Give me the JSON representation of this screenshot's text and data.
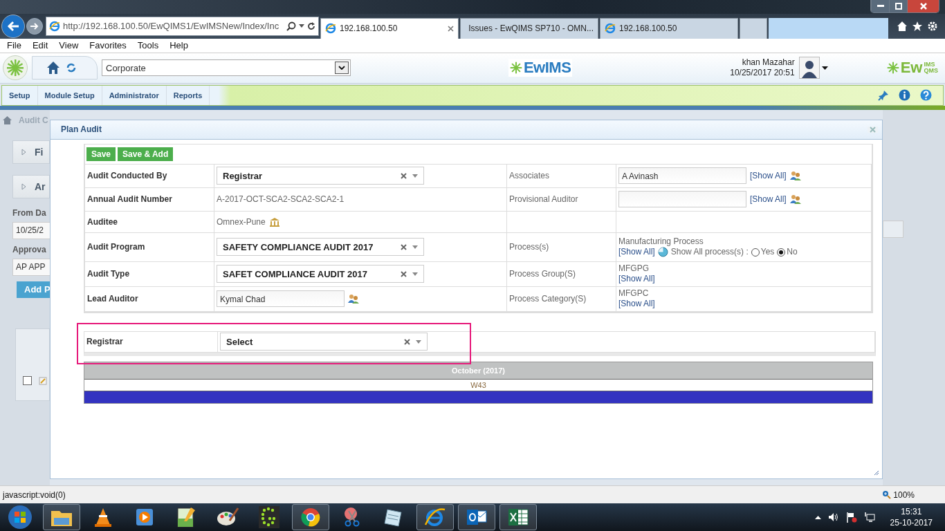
{
  "browser": {
    "url": "http://192.168.100.50/EwQIMS1/EwIMSNew/Index/Inc",
    "tabs": [
      {
        "title": "192.168.100.50",
        "selected": true,
        "kind": "globe"
      },
      {
        "title": "Issues - EwQIMS SP710 - OMN...",
        "selected": false,
        "kind": "gauge"
      },
      {
        "title": "192.168.100.50",
        "selected": false,
        "kind": "globe"
      }
    ],
    "menu": [
      "File",
      "Edit",
      "View",
      "Favorites",
      "Tools",
      "Help"
    ]
  },
  "header": {
    "site": "Corporate",
    "logo": "EwIMS",
    "user": "khan Mazahar",
    "datetime": "10/25/2017 20:51",
    "brand": {
      "main": "Ew",
      "top": "IMS",
      "bottom": "QMS"
    },
    "nav": [
      "Setup",
      "Module Setup",
      "Administrator",
      "Reports"
    ]
  },
  "background": {
    "breadcrumb": "Audit C",
    "panels": [
      "Fi",
      "Ar"
    ],
    "from_label": "From Da",
    "from_value": "10/25/2",
    "approval_label": "Approva",
    "approval_value": "AP APP",
    "add_button": "Add P",
    "row_checked": false
  },
  "dialog": {
    "title": "Plan Audit",
    "buttons": [
      "Save",
      "Save & Add"
    ],
    "left": [
      {
        "label": "Audit Conducted By",
        "kind": "select",
        "value": "Registrar"
      },
      {
        "label": "Annual Audit Number",
        "kind": "text",
        "value": "A-2017-OCT-SCA2-SCA2-SCA2-1"
      },
      {
        "label": "Auditee",
        "kind": "place",
        "value": "Omnex-Pune"
      },
      {
        "label": "Audit Program",
        "kind": "select",
        "value": "SAFETY COMPLIANCE AUDIT 2017"
      },
      {
        "label": "Audit Type",
        "kind": "select",
        "value": "SAFET COMPLIANCE AUDIT 2017"
      },
      {
        "label": "Lead Auditor",
        "kind": "person",
        "value": "Kymal Chad"
      }
    ],
    "right": [
      {
        "label": "Associates",
        "kind": "picker",
        "value": "A Avinash",
        "link": "[Show All]"
      },
      {
        "label": "Provisional Auditor",
        "kind": "picker",
        "link": "[Show All]"
      },
      {
        "kind": "empty"
      },
      {
        "label": "Process(s)",
        "kind": "process",
        "value": "Manufacturing Process",
        "link": "[Show All]",
        "question": "Show All process(s) :",
        "options": [
          {
            "label": "Yes",
            "selected": false
          },
          {
            "label": "No",
            "selected": true
          }
        ]
      },
      {
        "label": "Process Group(S)",
        "kind": "list",
        "value": "MFGPG",
        "link": "[Show All]"
      },
      {
        "label": "Process Category(S)",
        "kind": "list",
        "value": "MFGPC",
        "link": "[Show All]"
      }
    ],
    "registrar": {
      "label": "Registrar",
      "value": "Select"
    },
    "calendar": {
      "month": "October (2017)",
      "week": "W43"
    }
  },
  "status_bar": {
    "text": "javascript:void(0)",
    "zoom": "100%"
  },
  "taskbar": {
    "apps": [
      {
        "kind": "folder",
        "running": true
      },
      {
        "kind": "cone",
        "running": false
      },
      {
        "kind": "player",
        "running": false
      },
      {
        "kind": "editor",
        "running": false
      },
      {
        "kind": "palette",
        "running": false
      },
      {
        "kind": "dots",
        "running": false
      },
      {
        "kind": "browser",
        "running": true
      },
      {
        "kind": "scissors",
        "running": false
      },
      {
        "kind": "notepad",
        "running": false
      },
      {
        "kind": "globe",
        "running": true
      },
      {
        "kind": "mail",
        "running": true
      },
      {
        "kind": "sheet",
        "running": true
      }
    ],
    "time": "15:31",
    "date": "25-10-2017"
  }
}
